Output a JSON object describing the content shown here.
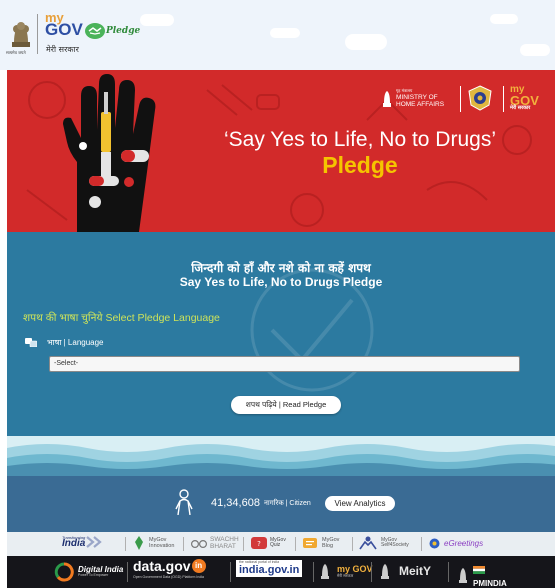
{
  "header": {
    "emblem_caption": "सत्यमेव जयते",
    "logo": {
      "my": "my",
      "gov": "GOV",
      "subtitle": "मेरी सरकार"
    },
    "pledge_word": "Pledge"
  },
  "banner": {
    "ministry_small": "गृह मंत्रालय",
    "ministry_line1": "MINISTRY OF",
    "ministry_line2": "HOME AFFAIRS",
    "mygov": {
      "my": "my",
      "gov": "GOV",
      "subtitle": "मेरी सरकार"
    },
    "title": "‘Say Yes to Life, No to Drugs’",
    "subtitle": "Pledge"
  },
  "main": {
    "heading_hindi": "जिन्दगी को हाँ और नशे को ना कहें शपथ",
    "heading_english": "Say Yes to Life, No to Drugs Pledge",
    "select_language_label": "शपथ की भाषा चुनिये Select Pledge Language",
    "language_label": "भाषा | Language",
    "dropdown_value": "-Select-",
    "read_button": "शपथ पढ़िये | Read Pledge"
  },
  "stats": {
    "count": "41,34,608",
    "label": "नागरिक | Citizen",
    "analytics_button": "View Analytics"
  },
  "footer_links": [
    {
      "label": "India",
      "pre": "Transforming"
    },
    {
      "label": "MyGov Innovation"
    },
    {
      "label": "SWACHH BHARAT"
    },
    {
      "label": "MyGov Quiz"
    },
    {
      "label": "MyGov Blog"
    },
    {
      "label": "MyGov Self4Society"
    },
    {
      "label": "eGreetings"
    }
  ],
  "footer_partners": [
    {
      "label": "Digital India",
      "sub": "Power To Empower"
    },
    {
      "label": "data.gov",
      "badge": "in",
      "sub": "Open Government Data (OGD) Platform India"
    },
    {
      "label": "india.gov.in",
      "sub": "the national portal of india"
    },
    {
      "label": "my GOV",
      "sub": "मेरी सरकार"
    },
    {
      "label": "MeitY"
    },
    {
      "label": "PMINDIA"
    }
  ],
  "colors": {
    "banner_red": "#d22a2a",
    "pledge_yellow": "#f5c400",
    "main_blue": "#2c7aa0",
    "stats_blue": "#3a6b94",
    "accent_lime": "#cde35a"
  }
}
